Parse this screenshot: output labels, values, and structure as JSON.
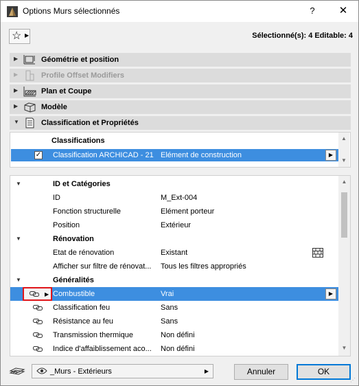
{
  "window": {
    "title": "Options Murs sélectionnés",
    "help": "?",
    "close": "✕"
  },
  "toolbar": {
    "selection_info": "Sélectionné(s): 4 Editable: 4"
  },
  "sections": [
    {
      "label": "Géométrie et position",
      "expanded": false,
      "enabled": true,
      "icon": "geometry-icon"
    },
    {
      "label": "Profile Offset Modifiers",
      "expanded": false,
      "enabled": false,
      "icon": "profile-icon"
    },
    {
      "label": "Plan et Coupe",
      "expanded": false,
      "enabled": true,
      "icon": "plan-section-icon"
    },
    {
      "label": "Modèle",
      "expanded": false,
      "enabled": true,
      "icon": "model-icon"
    },
    {
      "label": "Classification et Propriétés",
      "expanded": true,
      "enabled": true,
      "icon": "classification-icon"
    }
  ],
  "classifications": {
    "header": "Classifications",
    "row": {
      "checked": true,
      "system": "Classification ARCHICAD - 21",
      "value": "Elément de construction"
    }
  },
  "properties": {
    "groups": [
      {
        "title": "ID et Catégories",
        "rows": [
          {
            "key": "ID",
            "value": "M_Ext-004"
          },
          {
            "key": "Fonction structurelle",
            "value": "Elément porteur"
          },
          {
            "key": "Position",
            "value": "Extérieur"
          }
        ]
      },
      {
        "title": "Rénovation",
        "rows": [
          {
            "key": "Etat de rénovation",
            "value": "Existant"
          },
          {
            "key": "Afficher sur filtre de rénovat...",
            "value": "Tous les filtres appropriés"
          }
        ]
      },
      {
        "title": "Généralités",
        "rows": [
          {
            "key": "Combustible",
            "value": "Vrai"
          },
          {
            "key": "Classification feu",
            "value": "Sans"
          },
          {
            "key": "Résistance au feu",
            "value": "Sans"
          },
          {
            "key": "Transmission thermique",
            "value": "Non défini"
          },
          {
            "key": "Indice d'affaiblissement aco...",
            "value": "Non défini"
          }
        ]
      }
    ]
  },
  "footer": {
    "layer": "_Murs - Extérieurs",
    "cancel_label": "Annuler",
    "ok_label": "OK"
  },
  "colors": {
    "selection": "#3d8ee0",
    "section_bg": "#dcdcdc",
    "highlight_border": "#e0151a"
  }
}
